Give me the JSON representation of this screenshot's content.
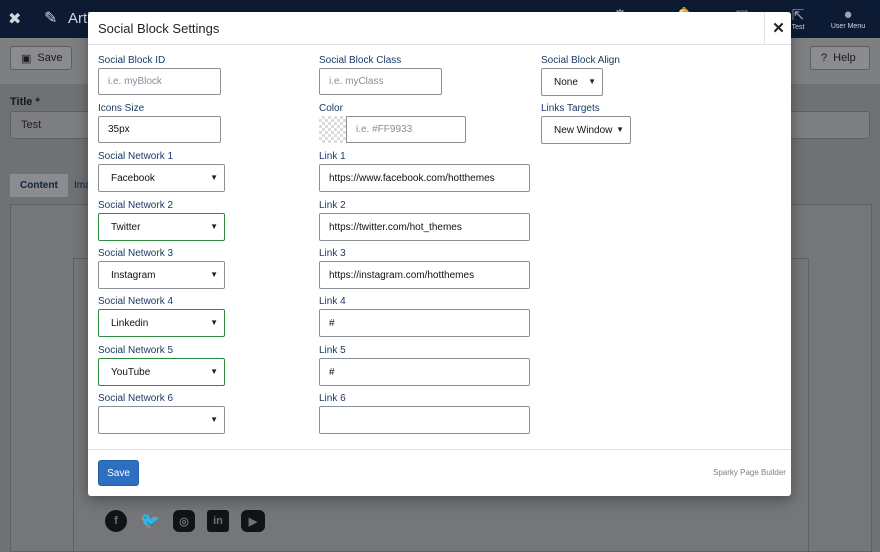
{
  "app": {
    "title": "Article: Edit",
    "topbar_icons": [
      {
        "name": "joomla-icon",
        "label": ""
      },
      {
        "name": "sparky-icon",
        "label": ""
      },
      {
        "name": "notifications-icon",
        "label": ""
      },
      {
        "name": "messages-icon",
        "label": ""
      },
      {
        "name": "external-link-icon",
        "label": "Test"
      },
      {
        "name": "user-icon",
        "label": "User Menu"
      }
    ],
    "toolbar": {
      "save_label": "Save",
      "help_label": "Help"
    },
    "title_field": {
      "label": "Title *",
      "value": "Test"
    },
    "tabs": [
      {
        "label": "Content"
      },
      {
        "label": "Ima"
      }
    ],
    "social_icons": [
      "facebook-icon",
      "twitter-icon",
      "instagram-icon",
      "linkedin-icon",
      "youtube-icon"
    ]
  },
  "modal": {
    "title": "Social Block Settings",
    "close_label": "✕",
    "fields": {
      "block_id": {
        "label": "Social Block ID",
        "placeholder": "i.e. myBlock",
        "value": ""
      },
      "block_class": {
        "label": "Social Block Class",
        "placeholder": "i.e. myClass",
        "value": ""
      },
      "block_align": {
        "label": "Social Block Align",
        "value": "None"
      },
      "icons_size": {
        "label": "Icons Size",
        "value": "35px"
      },
      "color": {
        "label": "Color",
        "placeholder": "i.e. #FF9933",
        "value": ""
      },
      "links_targets": {
        "label": "Links Targets",
        "value": "New Window"
      }
    },
    "networks": [
      {
        "label": "Social Network 1",
        "value": "Facebook",
        "link_label": "Link 1",
        "link": "https://www.facebook.com/hotthemes"
      },
      {
        "label": "Social Network 2",
        "value": "Twitter",
        "link_label": "Link 2",
        "link": "https://twitter.com/hot_themes"
      },
      {
        "label": "Social Network 3",
        "value": "Instagram",
        "link_label": "Link 3",
        "link": "https://instagram.com/hotthemes"
      },
      {
        "label": "Social Network 4",
        "value": "Linkedin",
        "link_label": "Link 4",
        "link": "#"
      },
      {
        "label": "Social Network 5",
        "value": "YouTube",
        "link_label": "Link 5",
        "link": "#"
      },
      {
        "label": "Social Network 6",
        "value": "",
        "link_label": "Link 6",
        "link": ""
      }
    ],
    "save_label": "Save",
    "brand": "Sparky Page Builder",
    "colors": {
      "primary": "#2f6fc1",
      "label": "#1b3a66",
      "valid_border": "#2d8a3e"
    }
  }
}
